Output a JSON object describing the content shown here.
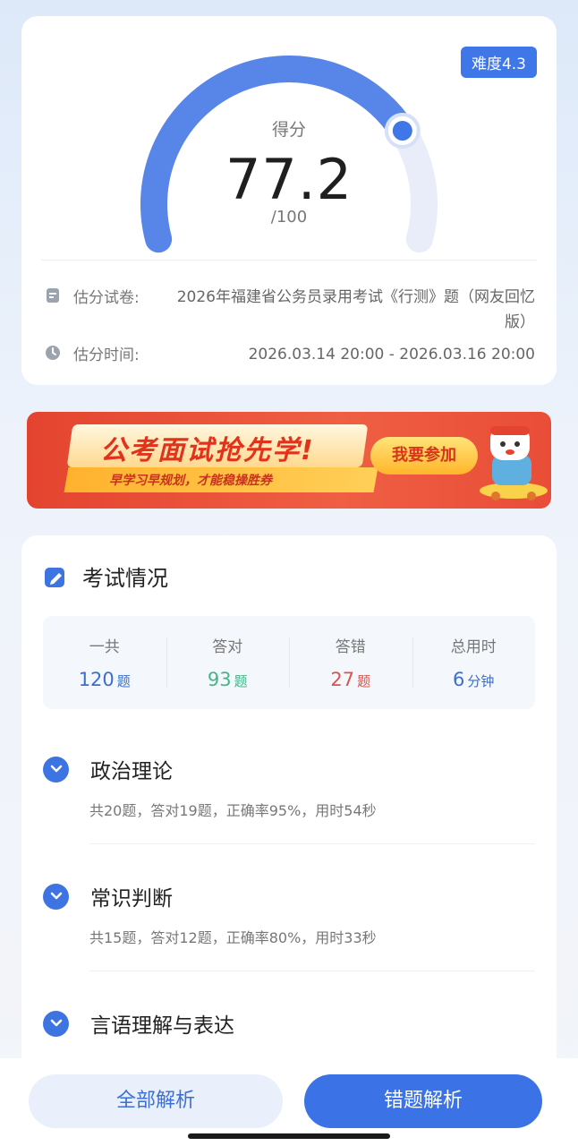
{
  "score": {
    "difficulty": "难度4.3",
    "label": "得分",
    "value": "77.2",
    "total": "/100",
    "progress": 0.772
  },
  "info": {
    "paper_label": "估分试卷:",
    "paper_value": "2026年福建省公务员录用考试《行测》题（网友回忆版）",
    "time_label": "估分时间:",
    "time_value": "2026.03.14 20:00 - 2026.03.16 20:00",
    "paper_icon": "document-icon",
    "time_icon": "clock-icon"
  },
  "banner": {
    "title": "公考面试抢先学!",
    "subtitle": "早学习早规划，才能稳操胜券",
    "button": "我要参加"
  },
  "exam": {
    "title": "考试情况",
    "stats": [
      {
        "label": "一共",
        "value": "120",
        "unit": "题"
      },
      {
        "label": "答对",
        "value": "93",
        "unit": "题"
      },
      {
        "label": "答错",
        "value": "27",
        "unit": "题"
      },
      {
        "label": "总用时",
        "value": "6",
        "unit": "分钟"
      }
    ],
    "categories": [
      {
        "name": "政治理论",
        "desc": "共20题，答对19题，正确率95%，用时54秒"
      },
      {
        "name": "常识判断",
        "desc": "共15题，答对12题，正确率80%，用时33秒"
      },
      {
        "name": "言语理解与表达",
        "desc": ""
      }
    ]
  },
  "actions": {
    "all_analysis": "全部解析",
    "wrong_analysis": "错题解析"
  },
  "colors": {
    "accent": "#3b72e5",
    "correct": "#45b58a",
    "wrong": "#d9534f"
  }
}
